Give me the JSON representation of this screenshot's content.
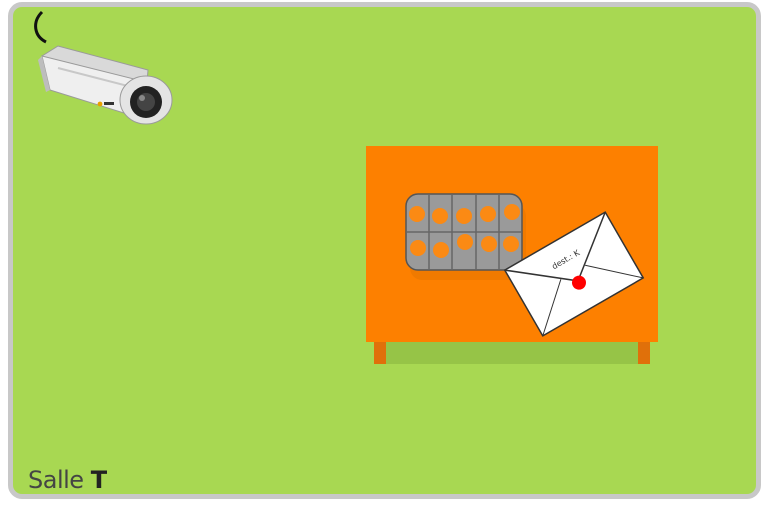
{
  "room": {
    "name_prefix": "Salle",
    "name_letter": "T",
    "background_color": "#a8d852",
    "border_color": "#c8c8c8"
  },
  "camera": {
    "icon": "security-camera-icon"
  },
  "table": {
    "color": "#fd8000",
    "leg_color": "#e0700a",
    "items": {
      "pill_box": {
        "icon": "pill-box-icon",
        "rows": 2,
        "columns": 5,
        "pill_color": "#fb8a14"
      },
      "envelope": {
        "icon": "envelope-icon",
        "label": "dest.: K",
        "seal_color": "#ff0000"
      }
    }
  }
}
